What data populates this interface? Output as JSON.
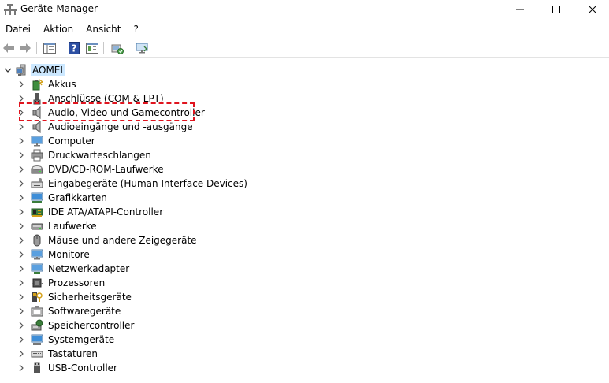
{
  "window": {
    "title": "Geräte-Manager"
  },
  "menu": {
    "items": [
      "Datei",
      "Aktion",
      "Ansicht",
      "?"
    ]
  },
  "tree": {
    "root_label": "AOMEI",
    "categories": [
      {
        "label": "Akkus",
        "icon": "battery-icon"
      },
      {
        "label": "Anschlüsse (COM & LPT)",
        "icon": "port-icon"
      },
      {
        "label": "Audio, Video und Gamecontroller",
        "icon": "speaker-icon"
      },
      {
        "label": "Audioeingänge und -ausgänge",
        "icon": "speaker-icon"
      },
      {
        "label": "Computer",
        "icon": "computer-icon"
      },
      {
        "label": "Druckwarteschlangen",
        "icon": "printer-icon"
      },
      {
        "label": "DVD/CD-ROM-Laufwerke",
        "icon": "disc-drive-icon"
      },
      {
        "label": "Eingabegeräte (Human Interface Devices)",
        "icon": "hid-icon"
      },
      {
        "label": "Grafikkarten",
        "icon": "display-adapter-icon"
      },
      {
        "label": "IDE ATA/ATAPI-Controller",
        "icon": "ide-controller-icon"
      },
      {
        "label": "Laufwerke",
        "icon": "disk-drive-icon"
      },
      {
        "label": "Mäuse und andere Zeigegeräte",
        "icon": "mouse-icon"
      },
      {
        "label": "Monitore",
        "icon": "monitor-icon"
      },
      {
        "label": "Netzwerkadapter",
        "icon": "network-adapter-icon"
      },
      {
        "label": "Prozessoren",
        "icon": "processor-icon"
      },
      {
        "label": "Sicherheitsgeräte",
        "icon": "security-device-icon"
      },
      {
        "label": "Softwaregeräte",
        "icon": "software-device-icon"
      },
      {
        "label": "Speichercontroller",
        "icon": "storage-controller-icon"
      },
      {
        "label": "Systemgeräte",
        "icon": "system-device-icon"
      },
      {
        "label": "Tastaturen",
        "icon": "keyboard-icon"
      },
      {
        "label": "USB-Controller",
        "icon": "usb-icon"
      }
    ]
  },
  "colors": {
    "selection": "#cce8ff",
    "highlight_outline": "#e0141e"
  }
}
